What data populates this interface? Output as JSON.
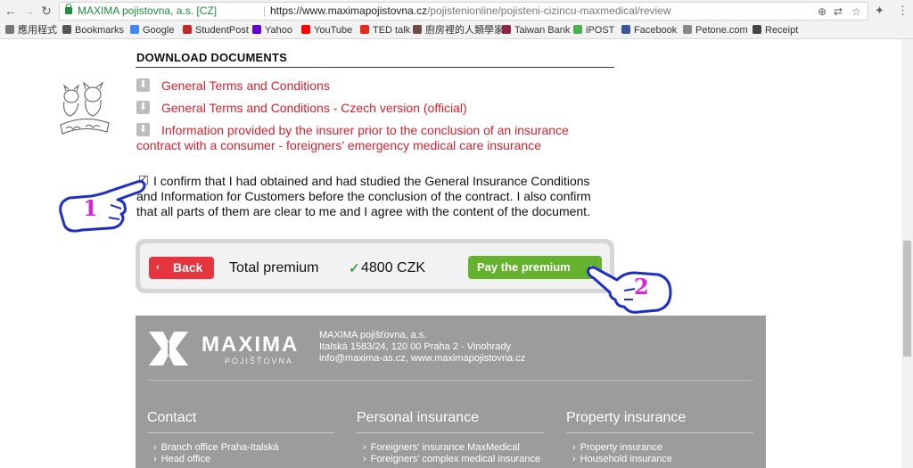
{
  "browser": {
    "site_identity": "MAXIMA pojistovna, a.s. [CZ]",
    "url_host": "https://www.maximapojistovna.cz",
    "url_path": "/pojistenionline/pojisteni-cizincu-maxmedical/review",
    "bookmarks": [
      {
        "label": "應用程式",
        "icon": "apps-icon",
        "color": "#777777"
      },
      {
        "label": "Bookmarks",
        "icon": "star-icon",
        "color": "#555555"
      },
      {
        "label": "Google",
        "icon": "google-icon",
        "color": "#4285f4"
      },
      {
        "label": "StudentPost",
        "icon": "studentpost-icon",
        "color": "#c62828"
      },
      {
        "label": "Yahoo",
        "icon": "yahoo-icon",
        "color": "#5f01d1"
      },
      {
        "label": "YouTube",
        "icon": "youtube-icon",
        "color": "#ff0000"
      },
      {
        "label": "TED talk",
        "icon": "ted-icon",
        "color": "#e62b1e"
      },
      {
        "label": "廚房裡的人類學家",
        "icon": "blog-icon",
        "color": "#6d4c41"
      },
      {
        "label": "Taiwan Bank",
        "icon": "bank-icon",
        "color": "#8e2447"
      },
      {
        "label": "iPOST",
        "icon": "ipost-icon",
        "color": "#4caf50"
      },
      {
        "label": "Facebook",
        "icon": "facebook-icon",
        "color": "#3b5998"
      },
      {
        "label": "Petone.com",
        "icon": "page-icon",
        "color": "#888888"
      },
      {
        "label": "Receipt",
        "icon": "receipt-icon",
        "color": "#444444"
      }
    ]
  },
  "documents": {
    "title": "DOWNLOAD DOCUMENTS",
    "items": [
      "General Terms and Conditions",
      "General Terms and Conditions - Czech version (official)",
      "Information provided by the insurer prior to the conclusion of an insurance contract with a consumer - foreigners' emergency medical care insurance"
    ]
  },
  "consent": {
    "checked": true,
    "text": "I confirm that I had obtained and had studied the General Insurance Conditions and Information for Customers before the conclusion of the contract. I also confirm that all parts of them are clear to me and I agree with the content of the document."
  },
  "payment": {
    "back_label": "Back",
    "total_label": "Total premium",
    "amount": "4800 CZK",
    "pay_label": "Pay the premium"
  },
  "annotations": {
    "step1": "1",
    "step2": "2",
    "color": "#e020e0"
  },
  "footer": {
    "logo_word": "MAXIMA",
    "logo_sub": "POJIŠŤOVNA",
    "company_lines": [
      "MAXIMA pojišťovna, a.s.",
      "Italská 1583/24, 120 00 Praha 2 - Vinohrady",
      "info@maxima-as.cz, www.maximapojistovna.cz"
    ],
    "columns": [
      {
        "title": "Contact",
        "items": [
          "Branch office Praha-Italská",
          "Head office"
        ]
      },
      {
        "title": "Personal insurance",
        "items": [
          "Foreigners' insurance MaxMedical",
          "Foreigners' complex medical insurance"
        ]
      },
      {
        "title": "Property insurance",
        "items": [
          "Property insurance",
          "Household insurance"
        ]
      }
    ]
  }
}
